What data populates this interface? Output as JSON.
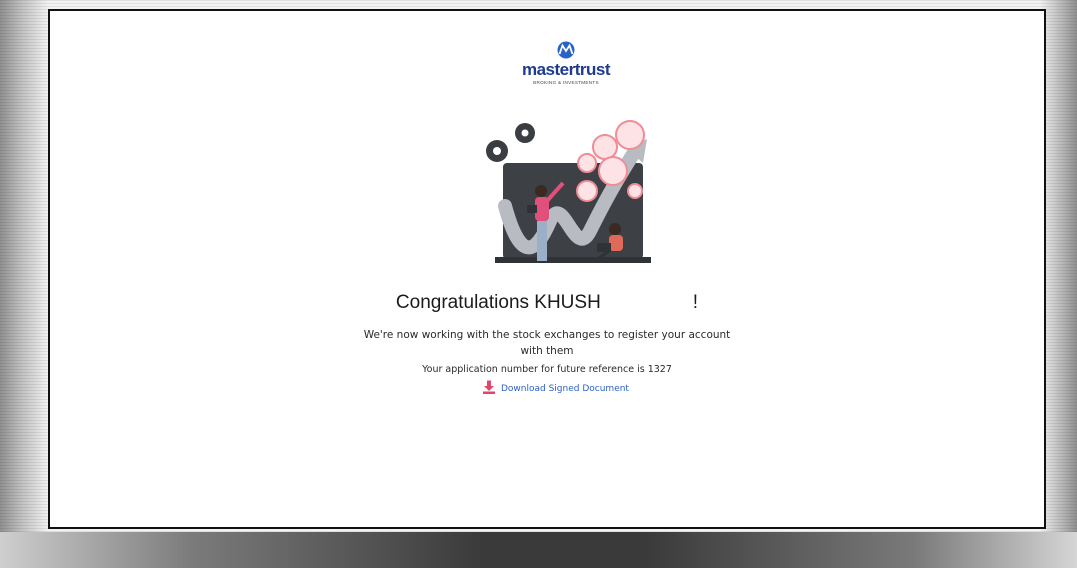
{
  "logo": {
    "word_master": "master",
    "word_trust": "trust",
    "tagline": "BROKING & INVESTMENTS"
  },
  "headline": {
    "prefix": "Congratulations KHUSH",
    "suffix": "!"
  },
  "message": {
    "line1": "We're now working with the stock exchanges to register your account",
    "line2": "with them"
  },
  "application": {
    "text": "Your application number for future reference is 1327"
  },
  "download": {
    "label": "Download Signed Document",
    "icon": "download-icon"
  },
  "colors": {
    "brand_blue": "#1e3b8f",
    "link_blue": "#2c62c7",
    "icon_pink": "#e2456b",
    "bubble": "#f08c96"
  }
}
